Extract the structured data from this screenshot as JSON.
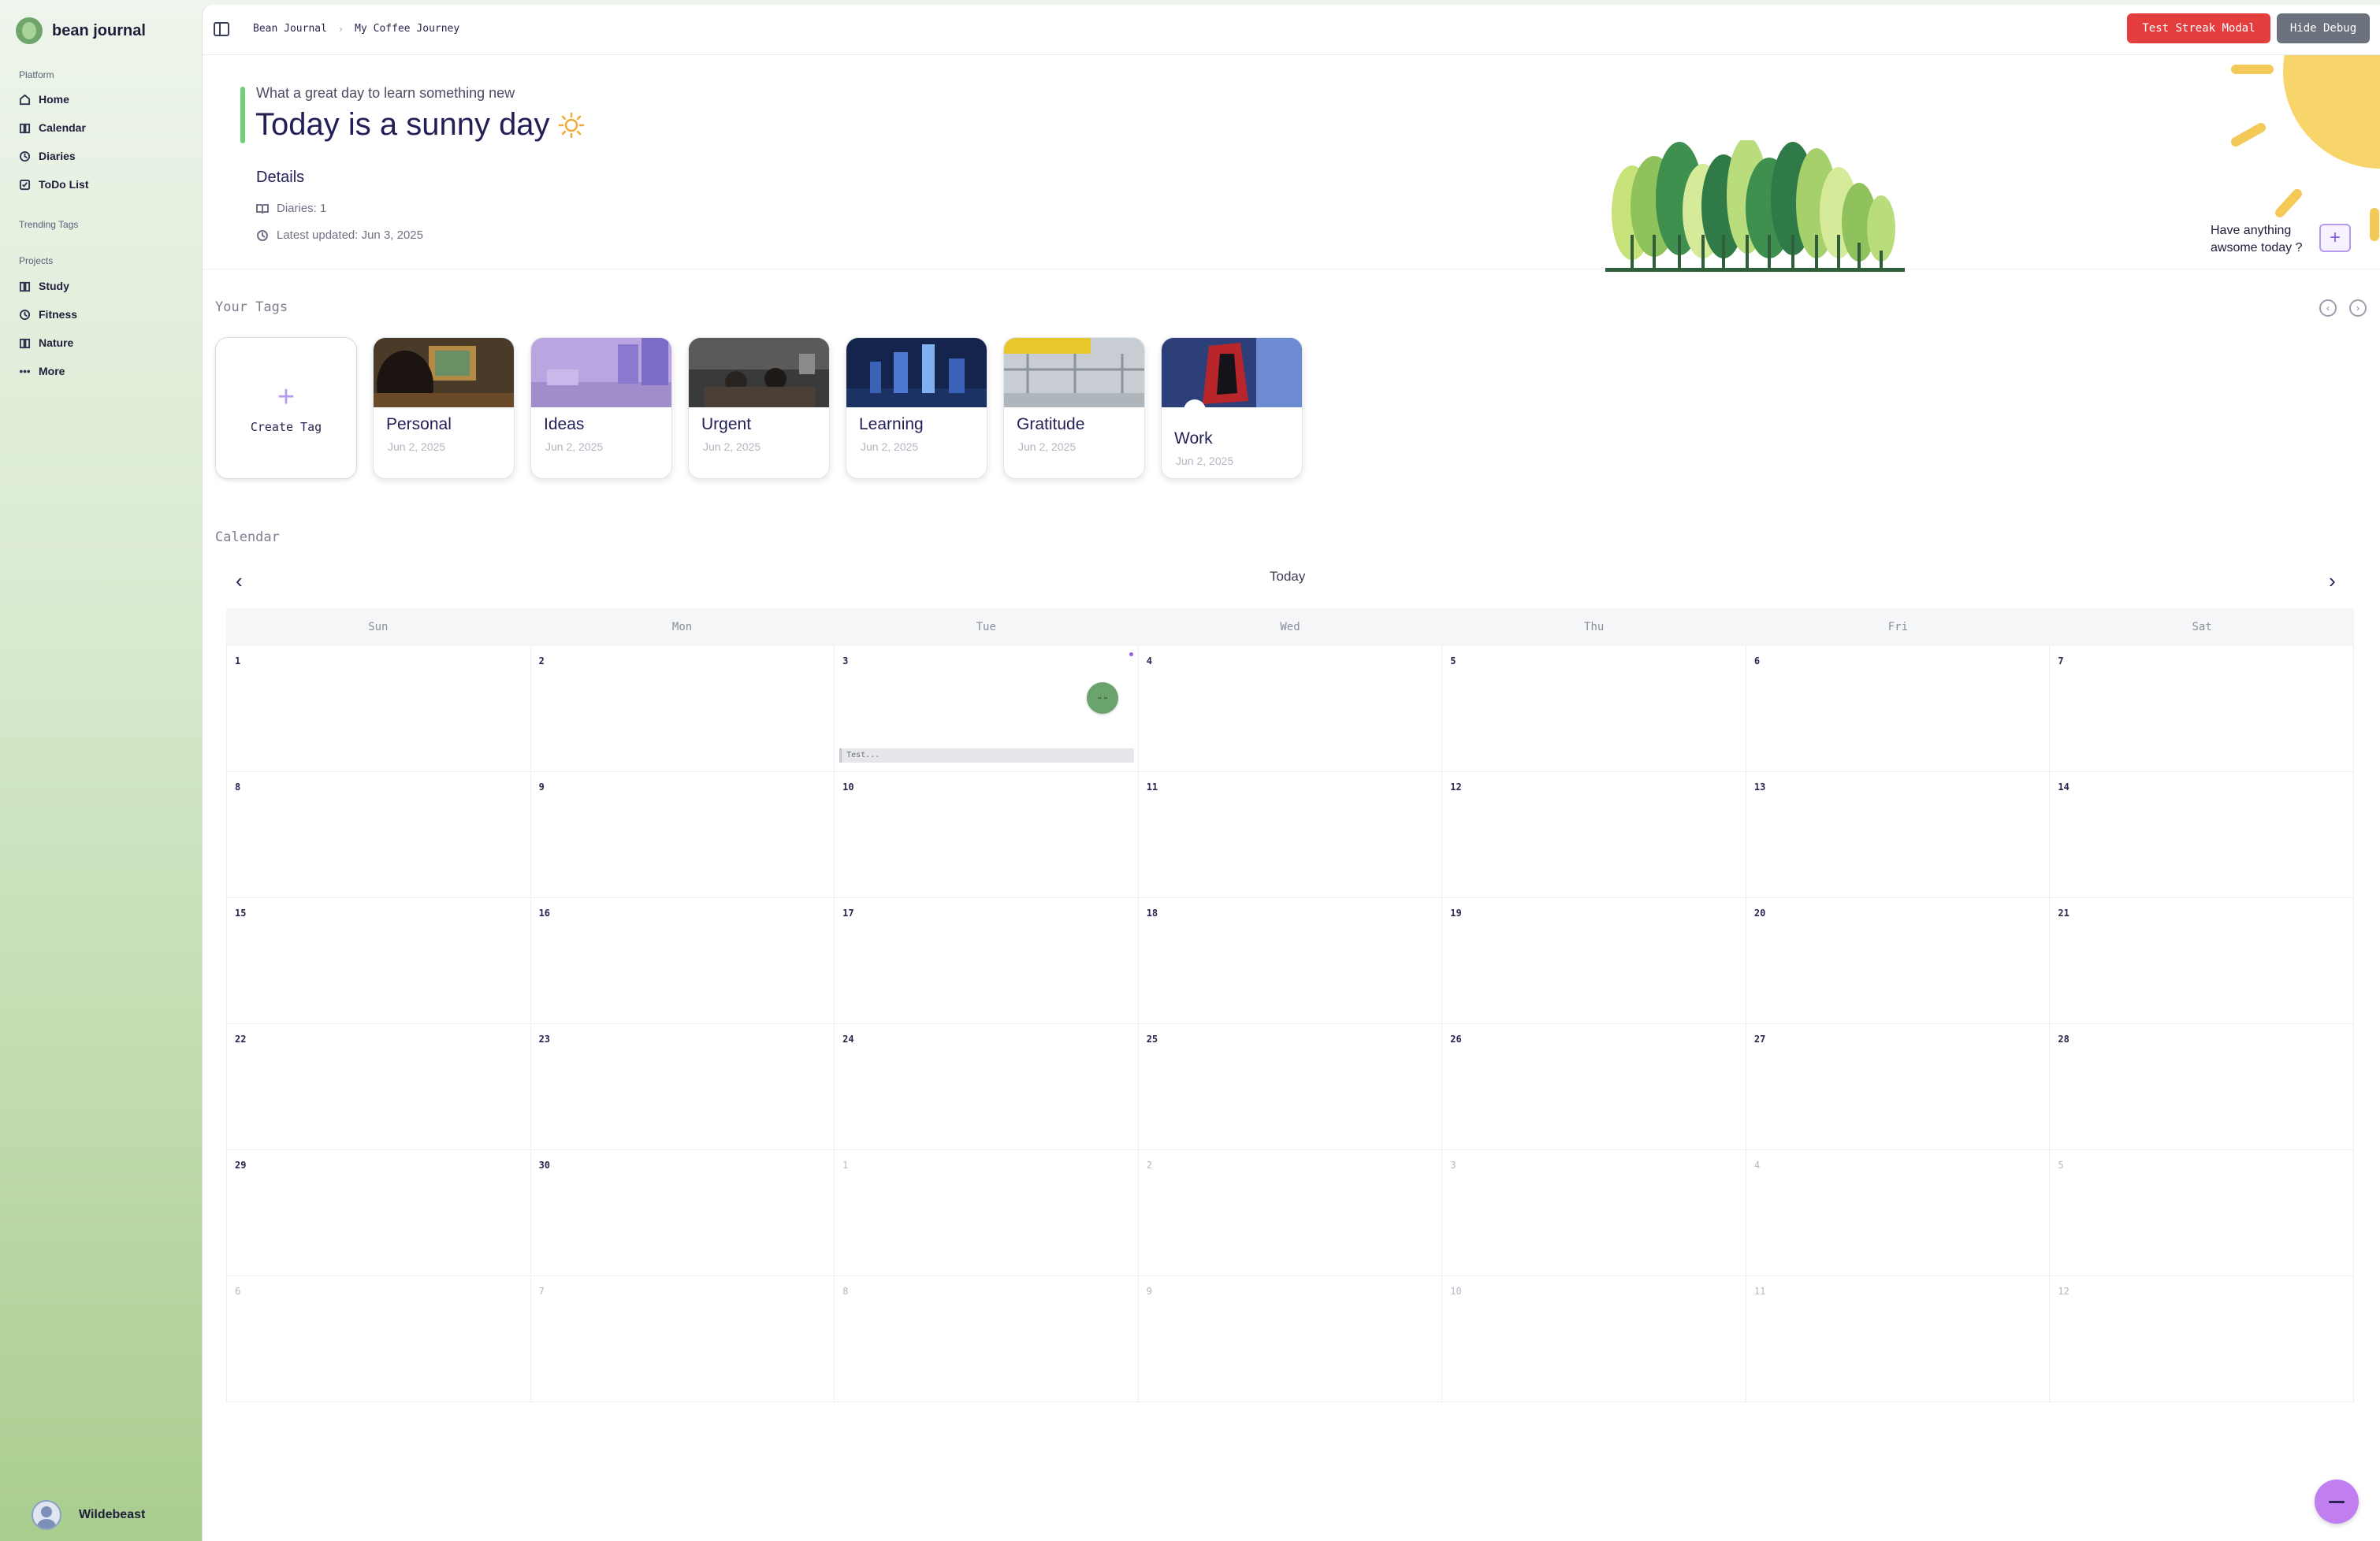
{
  "brand": {
    "name": "bean journal"
  },
  "sidebar": {
    "platform_label": "Platform",
    "platform_items": [
      {
        "label": "Home",
        "icon": "home-icon"
      },
      {
        "label": "Calendar",
        "icon": "book-icon"
      },
      {
        "label": "Diaries",
        "icon": "clock-icon"
      },
      {
        "label": "ToDo List",
        "icon": "checkbox-icon"
      }
    ],
    "trending_label": "Trending Tags",
    "projects_label": "Projects",
    "project_items": [
      {
        "label": "Study",
        "icon": "book-icon"
      },
      {
        "label": "Fitness",
        "icon": "clock-icon"
      },
      {
        "label": "Nature",
        "icon": "book-icon"
      },
      {
        "label": "More",
        "icon": "more-icon"
      }
    ],
    "user_name": "Wildebeast"
  },
  "topbar": {
    "breadcrumb": [
      "Bean Journal",
      "My Coffee Journey"
    ],
    "streak_button": "Test Streak Modal",
    "debug_button": "Hide Debug"
  },
  "hero": {
    "subtitle": "What a great day to learn something new",
    "title": "Today is a sunny day",
    "details_title": "Details",
    "diaries": "Diaries: 1",
    "latest_updated": "Latest updated: Jun 3, 2025",
    "prompt": "Have anything awsome today ?",
    "add_label": "+"
  },
  "tags": {
    "section_label": "Your Tags",
    "create_label": "Create Tag",
    "items": [
      {
        "name": "Personal",
        "date": "Jun 2, 2025"
      },
      {
        "name": "Ideas",
        "date": "Jun 2, 2025"
      },
      {
        "name": "Urgent",
        "date": "Jun 2, 2025"
      },
      {
        "name": "Learning",
        "date": "Jun 2, 2025"
      },
      {
        "name": "Gratitude",
        "date": "Jun 2, 2025"
      },
      {
        "name": "Work",
        "date": "Jun 2, 2025"
      }
    ]
  },
  "calendar": {
    "section_label": "Calendar",
    "today_label": "Today",
    "weekdays": [
      "Sun",
      "Mon",
      "Tue",
      "Wed",
      "Thu",
      "Fri",
      "Sat"
    ],
    "weeks": [
      [
        "1",
        "2",
        "3",
        "4",
        "5",
        "6",
        "7"
      ],
      [
        "8",
        "9",
        "10",
        "11",
        "12",
        "13",
        "14"
      ],
      [
        "15",
        "16",
        "17",
        "18",
        "19",
        "20",
        "21"
      ],
      [
        "22",
        "23",
        "24",
        "25",
        "26",
        "27",
        "28"
      ],
      [
        "29",
        "30",
        "1",
        "2",
        "3",
        "4",
        "5"
      ],
      [
        "6",
        "7",
        "8",
        "9",
        "10",
        "11",
        "12"
      ]
    ],
    "entry_day": "3",
    "entry_text": "Test...",
    "mood_face": "ᵕ ᵕ"
  },
  "colors": {
    "accent_green": "#6ed17a",
    "streak_red": "#e43d3d",
    "debug_gray": "#6b717d",
    "fab_purple": "#c17ef0"
  }
}
